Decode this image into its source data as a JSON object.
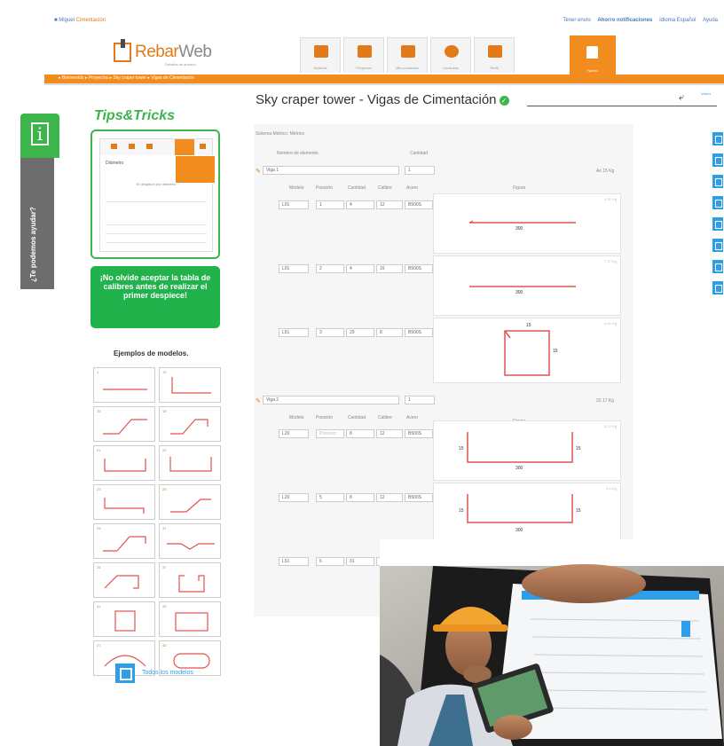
{
  "topbar": {
    "user": "Miguel",
    "user_suffix": "Cimentación",
    "links": [
      "Tener envío",
      "Ahorro notificaciones",
      "Idioma Español",
      "Ayuda"
    ]
  },
  "logo": {
    "rebar": "Rebar",
    "web": "Web",
    "tagline": "Detalles de armado"
  },
  "nav": {
    "tabs": [
      "Modelos",
      "Proyectos",
      "Mis comandos",
      "Consultas",
      "Perfil"
    ],
    "active": "Nuevo"
  },
  "breadcrumb": "▸ Bienvenido ▸ Proyectos ▸ Sky craper tower ▸ Vigas de Cimentación",
  "help": {
    "info": "i",
    "ask": "¿Te podemos ayudar?"
  },
  "tips": {
    "title": "Tips&Tricks",
    "mini_label": "Diámetro",
    "mini_text": "El despiece por diámetro",
    "message": "¡No olvide aceptar la tabla de calibres antes de realizar el primer despiece!"
  },
  "examples": {
    "title": "Ejemplos de modelos.",
    "numbers": [
      "1",
      "13",
      "15",
      "18",
      "21",
      "22",
      "23",
      "28",
      "29",
      "31",
      "34",
      "37",
      "41",
      "43",
      "47",
      "48"
    ],
    "all_label": "Todos los modelos"
  },
  "page": {
    "title": "Sky craper tower - Vigas de Cimentación",
    "back": "Volver",
    "system": "Sistema Métrico: Métrico"
  },
  "headers": {
    "element": "Nombre de elemento",
    "qty": "Cantidad",
    "cols": [
      "Modelo",
      "Posición",
      "Cantidad",
      "Calibre",
      "Acero"
    ],
    "figure": "Figura"
  },
  "elements": [
    {
      "name": "Viga 1",
      "qty": "1",
      "total": "Ax 15 Kg",
      "rows": [
        {
          "cells": [
            "L01",
            "1",
            "4",
            "12",
            "B500S"
          ],
          "weight": "4.31 Kg",
          "dims": [
            "300"
          ]
        },
        {
          "cells": [
            "L01",
            "2",
            "4",
            "16",
            "B500S"
          ],
          "weight": "7.27 Kg",
          "dims": [
            "300"
          ]
        },
        {
          "cells": [
            "L51",
            "3",
            "20",
            "8",
            "B500S"
          ],
          "weight": "4.61 Kg",
          "dims": [
            "15",
            "15"
          ]
        }
      ]
    },
    {
      "name": "Viga 2",
      "qty": "1",
      "total": "22.17 Kg",
      "rows": [
        {
          "cells": [
            "L20",
            "Posición",
            "8",
            "12",
            "B500S"
          ],
          "weight": "8.12 Kg",
          "dims": [
            "15",
            "300",
            "15"
          ]
        },
        {
          "cells": [
            "L20",
            "5",
            "8",
            "12",
            "B500S"
          ],
          "weight": "8.1 Kg",
          "dims": [
            "15",
            "300",
            "15"
          ]
        },
        {
          "cells": [
            "L51",
            "6",
            "31",
            "8",
            "B500S"
          ],
          "weight": "",
          "dims": []
        }
      ]
    }
  ],
  "colors": {
    "orange": "#f28c1e",
    "green": "#3cb54a",
    "blue": "#2e9ee8",
    "bar": "#e0544f"
  }
}
